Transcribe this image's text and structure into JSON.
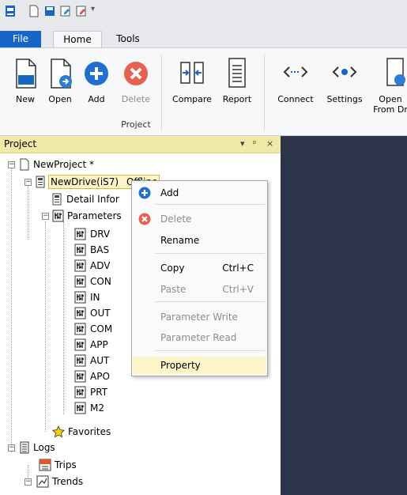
{
  "ribbon_tabs": {
    "file": "File",
    "home": "Home",
    "tools": "Tools"
  },
  "ribbon": {
    "buttons": [
      {
        "label": "New"
      },
      {
        "label": "Open"
      },
      {
        "label": "Add"
      },
      {
        "label": "Delete"
      },
      {
        "label": "Compare"
      },
      {
        "label": "Report"
      },
      {
        "label": "Connect"
      },
      {
        "label": "Settings"
      },
      {
        "label": "Open\nFrom Dr"
      }
    ],
    "group_label": "Project"
  },
  "pane": {
    "title": "Project",
    "pin": "▾  ᵖ  ×"
  },
  "tree": {
    "project": "NewProject *",
    "drive": "NewDrive(iS7)",
    "drive_status": "Offline",
    "detail": "Detail Infor",
    "parameters": "Parameters",
    "groups": [
      "DRV",
      "BAS",
      "ADV",
      "CON",
      "IN",
      "OUT",
      "COM",
      "APP",
      "AUT",
      "APO",
      "PRT",
      "M2"
    ],
    "favorites": "Favorites",
    "logs": "Logs",
    "trips": "Trips",
    "trends": "Trends"
  },
  "context_menu": {
    "add": "Add",
    "delete": "Delete",
    "rename": "Rename",
    "copy": "Copy",
    "copy_shortcut": "Ctrl+C",
    "paste": "Paste",
    "paste_shortcut": "Ctrl+V",
    "param_write": "Parameter Write",
    "param_read": "Parameter Read",
    "property": "Property"
  },
  "colors": {
    "accent": "#1566c6",
    "dark_panel": "#2b3448",
    "pane_header": "#f1e9a8",
    "highlight": "#fdf4c8"
  }
}
